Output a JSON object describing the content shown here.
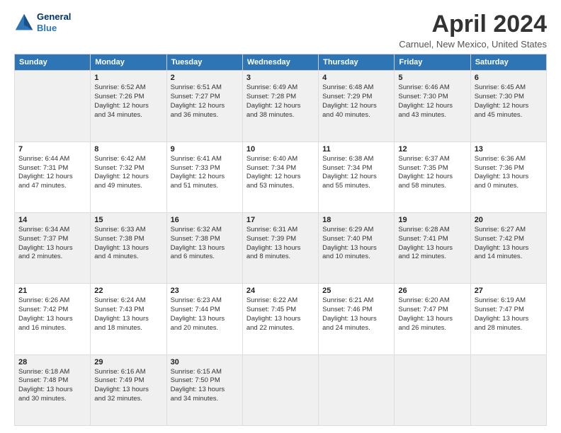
{
  "header": {
    "logo_line1": "General",
    "logo_line2": "Blue",
    "title": "April 2024",
    "subtitle": "Carnuel, New Mexico, United States"
  },
  "weekdays": [
    "Sunday",
    "Monday",
    "Tuesday",
    "Wednesday",
    "Thursday",
    "Friday",
    "Saturday"
  ],
  "weeks": [
    [
      {
        "day": "",
        "info": ""
      },
      {
        "day": "1",
        "info": "Sunrise: 6:52 AM\nSunset: 7:26 PM\nDaylight: 12 hours\nand 34 minutes."
      },
      {
        "day": "2",
        "info": "Sunrise: 6:51 AM\nSunset: 7:27 PM\nDaylight: 12 hours\nand 36 minutes."
      },
      {
        "day": "3",
        "info": "Sunrise: 6:49 AM\nSunset: 7:28 PM\nDaylight: 12 hours\nand 38 minutes."
      },
      {
        "day": "4",
        "info": "Sunrise: 6:48 AM\nSunset: 7:29 PM\nDaylight: 12 hours\nand 40 minutes."
      },
      {
        "day": "5",
        "info": "Sunrise: 6:46 AM\nSunset: 7:30 PM\nDaylight: 12 hours\nand 43 minutes."
      },
      {
        "day": "6",
        "info": "Sunrise: 6:45 AM\nSunset: 7:30 PM\nDaylight: 12 hours\nand 45 minutes."
      }
    ],
    [
      {
        "day": "7",
        "info": "Sunrise: 6:44 AM\nSunset: 7:31 PM\nDaylight: 12 hours\nand 47 minutes."
      },
      {
        "day": "8",
        "info": "Sunrise: 6:42 AM\nSunset: 7:32 PM\nDaylight: 12 hours\nand 49 minutes."
      },
      {
        "day": "9",
        "info": "Sunrise: 6:41 AM\nSunset: 7:33 PM\nDaylight: 12 hours\nand 51 minutes."
      },
      {
        "day": "10",
        "info": "Sunrise: 6:40 AM\nSunset: 7:34 PM\nDaylight: 12 hours\nand 53 minutes."
      },
      {
        "day": "11",
        "info": "Sunrise: 6:38 AM\nSunset: 7:34 PM\nDaylight: 12 hours\nand 55 minutes."
      },
      {
        "day": "12",
        "info": "Sunrise: 6:37 AM\nSunset: 7:35 PM\nDaylight: 12 hours\nand 58 minutes."
      },
      {
        "day": "13",
        "info": "Sunrise: 6:36 AM\nSunset: 7:36 PM\nDaylight: 13 hours\nand 0 minutes."
      }
    ],
    [
      {
        "day": "14",
        "info": "Sunrise: 6:34 AM\nSunset: 7:37 PM\nDaylight: 13 hours\nand 2 minutes."
      },
      {
        "day": "15",
        "info": "Sunrise: 6:33 AM\nSunset: 7:38 PM\nDaylight: 13 hours\nand 4 minutes."
      },
      {
        "day": "16",
        "info": "Sunrise: 6:32 AM\nSunset: 7:38 PM\nDaylight: 13 hours\nand 6 minutes."
      },
      {
        "day": "17",
        "info": "Sunrise: 6:31 AM\nSunset: 7:39 PM\nDaylight: 13 hours\nand 8 minutes."
      },
      {
        "day": "18",
        "info": "Sunrise: 6:29 AM\nSunset: 7:40 PM\nDaylight: 13 hours\nand 10 minutes."
      },
      {
        "day": "19",
        "info": "Sunrise: 6:28 AM\nSunset: 7:41 PM\nDaylight: 13 hours\nand 12 minutes."
      },
      {
        "day": "20",
        "info": "Sunrise: 6:27 AM\nSunset: 7:42 PM\nDaylight: 13 hours\nand 14 minutes."
      }
    ],
    [
      {
        "day": "21",
        "info": "Sunrise: 6:26 AM\nSunset: 7:42 PM\nDaylight: 13 hours\nand 16 minutes."
      },
      {
        "day": "22",
        "info": "Sunrise: 6:24 AM\nSunset: 7:43 PM\nDaylight: 13 hours\nand 18 minutes."
      },
      {
        "day": "23",
        "info": "Sunrise: 6:23 AM\nSunset: 7:44 PM\nDaylight: 13 hours\nand 20 minutes."
      },
      {
        "day": "24",
        "info": "Sunrise: 6:22 AM\nSunset: 7:45 PM\nDaylight: 13 hours\nand 22 minutes."
      },
      {
        "day": "25",
        "info": "Sunrise: 6:21 AM\nSunset: 7:46 PM\nDaylight: 13 hours\nand 24 minutes."
      },
      {
        "day": "26",
        "info": "Sunrise: 6:20 AM\nSunset: 7:47 PM\nDaylight: 13 hours\nand 26 minutes."
      },
      {
        "day": "27",
        "info": "Sunrise: 6:19 AM\nSunset: 7:47 PM\nDaylight: 13 hours\nand 28 minutes."
      }
    ],
    [
      {
        "day": "28",
        "info": "Sunrise: 6:18 AM\nSunset: 7:48 PM\nDaylight: 13 hours\nand 30 minutes."
      },
      {
        "day": "29",
        "info": "Sunrise: 6:16 AM\nSunset: 7:49 PM\nDaylight: 13 hours\nand 32 minutes."
      },
      {
        "day": "30",
        "info": "Sunrise: 6:15 AM\nSunset: 7:50 PM\nDaylight: 13 hours\nand 34 minutes."
      },
      {
        "day": "",
        "info": ""
      },
      {
        "day": "",
        "info": ""
      },
      {
        "day": "",
        "info": ""
      },
      {
        "day": "",
        "info": ""
      }
    ]
  ],
  "shaded_rows": [
    0,
    2,
    4
  ]
}
